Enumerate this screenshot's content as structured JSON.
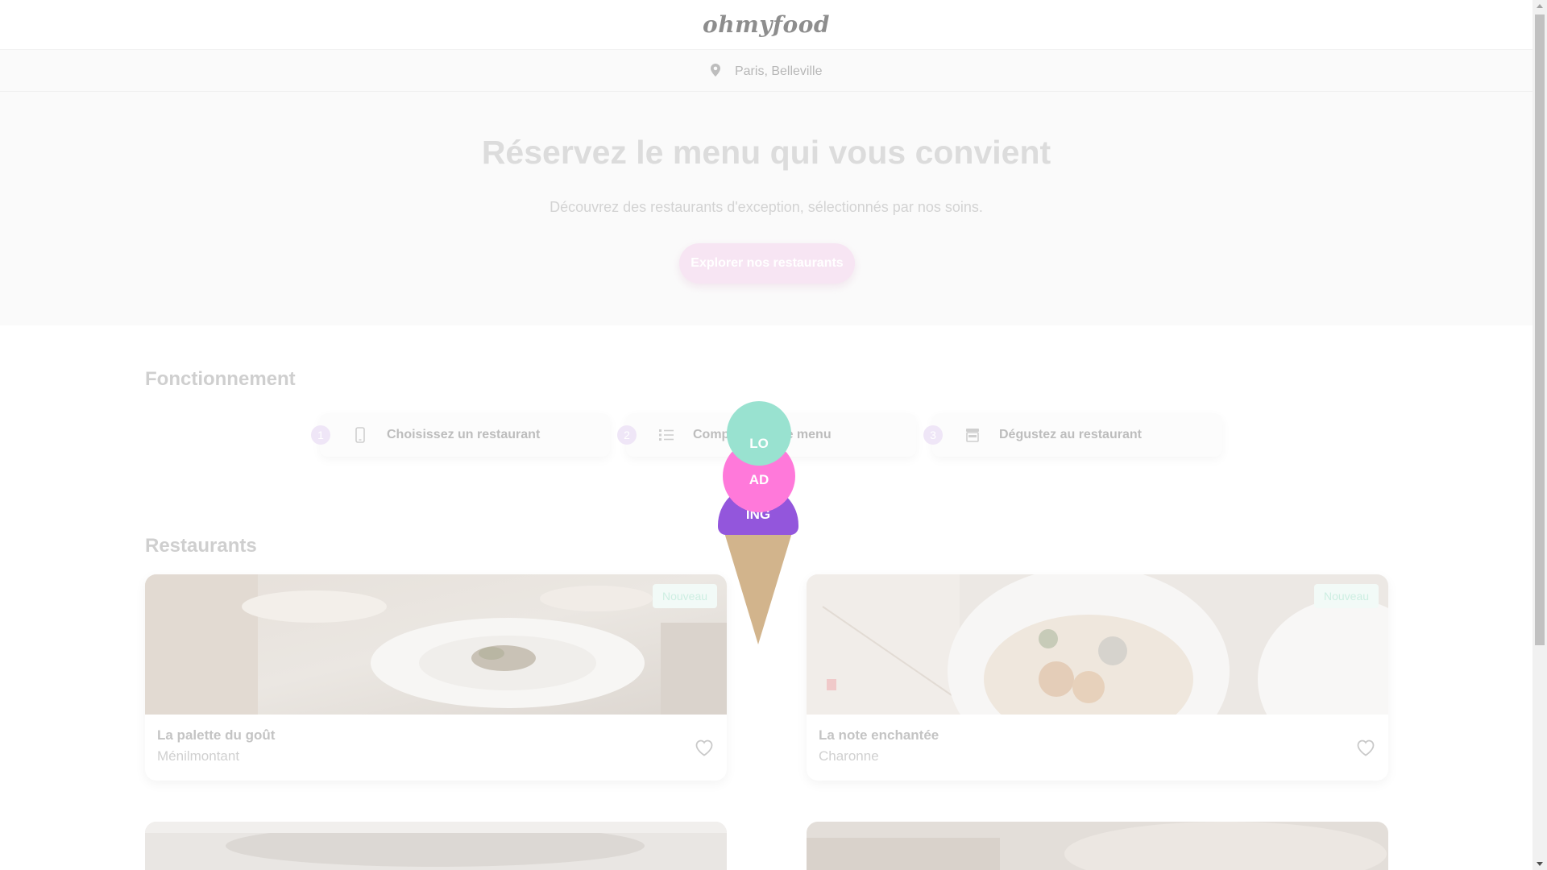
{
  "header": {
    "logo": "ohmyfood"
  },
  "location": {
    "text": "Paris, Belleville",
    "icon": "map-pin-icon"
  },
  "hero": {
    "title": "Réservez le menu qui vous convient",
    "subtitle": "Découvrez des restaurants d'exception, sélectionnés par nos soins.",
    "cta_label": "Explorer nos restaurants"
  },
  "how": {
    "title": "Fonctionnement",
    "steps": [
      {
        "number": "1",
        "label": "Choisissez un restaurant",
        "icon": "mobile-phone-icon"
      },
      {
        "number": "2",
        "label": "Composez votre menu",
        "icon": "list-icon"
      },
      {
        "number": "3",
        "label": "Dégustez au restaurant",
        "icon": "store-icon"
      }
    ]
  },
  "restaurants": {
    "title": "Restaurants",
    "items": [
      {
        "name": "La palette du goût",
        "area": "Ménilmontant",
        "badge": "Nouveau"
      },
      {
        "name": "La note enchantée",
        "area": "Charonne",
        "badge": "Nouveau"
      }
    ]
  },
  "loader": {
    "scoops": [
      "LO",
      "AD",
      "ING"
    ],
    "colors": {
      "top": "#99e2d0",
      "middle": "#ff79da",
      "bottom": "#9356dc",
      "cone": "#d2b48c"
    }
  },
  "colors": {
    "accent": "#9356dc",
    "accent_pink": "#ff79da",
    "accent_mint": "#99e2d0"
  }
}
